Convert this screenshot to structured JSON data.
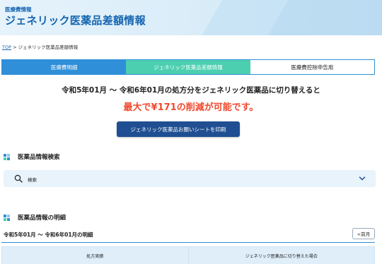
{
  "header": {
    "subtitle": "医療費情報",
    "title": "ジェネリック医薬品差額情報"
  },
  "breadcrumb": {
    "top": "TOP",
    "separator": ">",
    "current": "ジェネリック医薬品差額情報"
  },
  "tabs": [
    {
      "label": "医療費明細"
    },
    {
      "label": "ジェネリック医薬品差額情報"
    },
    {
      "label": "医療費控除申告用"
    }
  ],
  "summary": {
    "period_text": "令和5年01月 ～ 令和6年01月の処方分をジェネリック医薬品に切り替えると",
    "savings_text": "最大で¥171の削減が可能です。"
  },
  "print_button": "ジェネリック医薬品お願いシートを印刷",
  "search_section": {
    "heading": "医薬品情報検索",
    "bar_label": "検索"
  },
  "detail_section": {
    "heading": "医薬品情報の明細",
    "period": "令和5年01月 ～ 令和6年01月の明細",
    "prev_button": "<前月",
    "columns": [
      "処方実績",
      "ジェネリック医薬品に切り替えた場合"
    ]
  },
  "colors": {
    "brand_blue": "#1565b0",
    "tab_active": "#2f8fd8",
    "tab_generic": "#4ccfb0",
    "savings_red": "#f0492d",
    "button_navy": "#1f4f92"
  },
  "icons": {
    "search": "search-icon",
    "chevron": "chevron-down-icon",
    "section": "grid-squares-icon"
  }
}
